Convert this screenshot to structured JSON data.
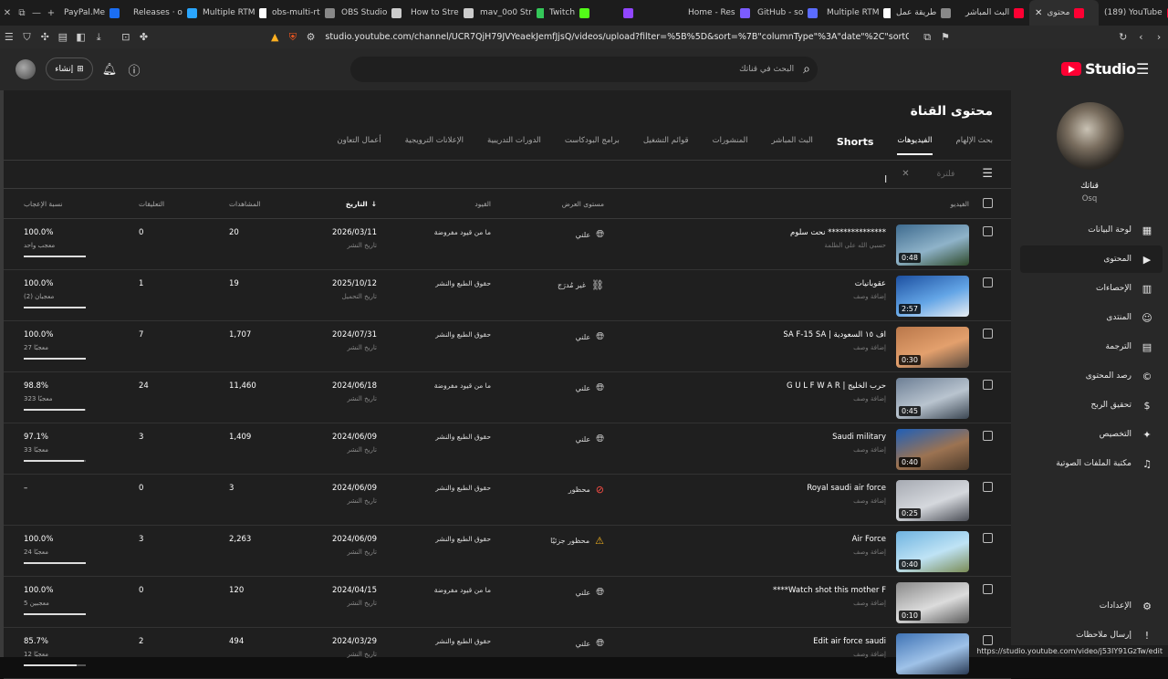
{
  "browser": {
    "tabs": [
      {
        "label": "PayPal.Me",
        "color": "#1b6ef3"
      },
      {
        "label": "Releases · o",
        "color": "#2aa6ff"
      },
      {
        "label": "Multiple RTM",
        "color": "#ffffff"
      },
      {
        "label": "obs-multi-rt",
        "color": "#888888"
      },
      {
        "label": "OBS Studio",
        "color": "#cccccc"
      },
      {
        "label": "How to Stre",
        "color": "#cccccc"
      },
      {
        "label": "mav_0o0 Str",
        "color": "#34c759"
      },
      {
        "label": "Twitch",
        "color": "#53fc18"
      },
      {
        "label": "",
        "color": "#9146ff"
      },
      {
        "label": "Home - Res",
        "color": "#7b5cff"
      },
      {
        "label": "GitHub - so",
        "color": "#5b6cff"
      },
      {
        "label": "Multiple RTM",
        "color": "#ffffff"
      },
      {
        "label": "طريقة عمل",
        "color": "#888888"
      },
      {
        "label": "البث المباشر",
        "color": "#ff0033"
      },
      {
        "label": "محتوى",
        "color": "#ff0033",
        "active": true
      },
      {
        "label": "(189) YouTube",
        "color": "#ff0033"
      }
    ],
    "url": "studio.youtube.com/channel/UCR7QjH79JVYeaekJemfJjsQ/videos/upload?filter=%5B%5D&sort=%7B\"columnType\"%3A\"date\"%2C\"sortOrder\"%3A\"D...",
    "status_url": "https://studio.youtube.com/video/j53IY91GzTw/edit"
  },
  "header": {
    "create_label": "إنشاء",
    "search_placeholder": "البحث في قناتك",
    "logo_text": "Studio"
  },
  "sidebar": {
    "channel_name": "قناتك",
    "channel_handle": "Osq",
    "items": [
      {
        "label": "لوحة البيانات",
        "icon": "dashboard-icon",
        "glyph": "▦"
      },
      {
        "label": "المحتوى",
        "icon": "content-icon",
        "glyph": "▶",
        "active": true
      },
      {
        "label": "الإحصاءات",
        "icon": "analytics-icon",
        "glyph": "▥"
      },
      {
        "label": "المنتدى",
        "icon": "community-icon",
        "glyph": "☺"
      },
      {
        "label": "الترجمة",
        "icon": "subtitles-icon",
        "glyph": "▤"
      },
      {
        "label": "رصد المحتوى",
        "icon": "copyright-icon",
        "glyph": "©"
      },
      {
        "label": "تحقيق الربح",
        "icon": "monetization-icon",
        "glyph": "$"
      },
      {
        "label": "التخصيص",
        "icon": "customization-icon",
        "glyph": "✦"
      },
      {
        "label": "مكتبة الملفات الصوتية",
        "icon": "audio-library-icon",
        "glyph": "♫"
      }
    ],
    "settings_label": "الإعدادات",
    "feedback_label": "إرسال ملاحظات"
  },
  "main": {
    "title": "محتوى القناة",
    "tabs": [
      {
        "label": "بحث الإلهام"
      },
      {
        "label": "الفيديوهات",
        "active": true
      },
      {
        "label": "Shorts",
        "bold": true
      },
      {
        "label": "البث المباشر"
      },
      {
        "label": "المنشورات"
      },
      {
        "label": "قوائم التشغيل"
      },
      {
        "label": "برامج البودكاست"
      },
      {
        "label": "الدورات التدريبية"
      },
      {
        "label": "الإعلانات الترويجية"
      },
      {
        "label": "أعمال التعاون"
      }
    ],
    "filter_placeholder": "فلترة",
    "columns": {
      "video": "الفيديو",
      "visibility": "مستوى العرض",
      "restrictions": "القيود",
      "date": "التاريخ",
      "views": "المشاهدات",
      "comments": "التعليقات",
      "likes": "نسبة الإعجاب"
    },
    "rows": [
      {
        "title": "نحت سلوم ***************",
        "desc": "حسبي الله علي الظلمة",
        "duration": "0:48",
        "visibility": "علني",
        "vis_icon": "globe",
        "restrictions": "ما من قيود مفروضة",
        "date": "2026/03/11",
        "date_sub": "تاريخ النشر",
        "views": "20",
        "comments": "0",
        "likes": "100.0%",
        "likes_sub": "معجب واحد",
        "like_ratio": 1.0,
        "thumb": [
          "#3e6b8f",
          "#8fb3c9",
          "#2f4a2a"
        ]
      },
      {
        "title": "عقوبانيات",
        "desc": "إضافة وصف",
        "duration": "2:57",
        "visibility": "غير مُدرَج",
        "vis_icon": "link",
        "restrictions": "حقوق الطبع والنشر",
        "date": "2025/10/12",
        "date_sub": "تاريخ التحميل",
        "views": "19",
        "comments": "1",
        "likes": "100.0%",
        "likes_sub": "معجبان (2)",
        "like_ratio": 1.0,
        "thumb": [
          "#1c4fa0",
          "#63a5e6",
          "#e9eef3"
        ]
      },
      {
        "title": "SA F-15 SA | اف ١٥ السعودية",
        "desc": "إضافة وصف",
        "duration": "0:30",
        "visibility": "علني",
        "vis_icon": "globe",
        "restrictions": "حقوق الطبع والنشر",
        "date": "2024/07/31",
        "date_sub": "تاريخ النشر",
        "views": "1,707",
        "comments": "7",
        "likes": "100.0%",
        "likes_sub": "27 معجبًا",
        "like_ratio": 1.0,
        "thumb": [
          "#b9774a",
          "#e3a06d",
          "#5a4a3e"
        ]
      },
      {
        "title": "G U L F W A R | حرب الخليج",
        "desc": "إضافة وصف",
        "duration": "0:45",
        "visibility": "علني",
        "vis_icon": "globe",
        "restrictions": "ما من قيود مفروضة",
        "date": "2024/06/18",
        "date_sub": "تاريخ النشر",
        "views": "11,460",
        "comments": "24",
        "likes": "98.8%",
        "likes_sub": "323 معجبًا",
        "like_ratio": 0.988,
        "thumb": [
          "#6d7f95",
          "#b9c4cf",
          "#3b4652"
        ]
      },
      {
        "title": "Saudi military",
        "desc": "إضافة وصف",
        "duration": "0:40",
        "visibility": "علني",
        "vis_icon": "globe",
        "restrictions": "حقوق الطبع والنشر",
        "date": "2024/06/09",
        "date_sub": "تاريخ النشر",
        "views": "1,409",
        "comments": "3",
        "likes": "97.1%",
        "likes_sub": "33 معجبًا",
        "like_ratio": 0.971,
        "thumb": [
          "#1f5fb8",
          "#9c7352",
          "#4c3a2a"
        ]
      },
      {
        "title": "Royal saudi air force",
        "desc": "إضافة وصف",
        "duration": "0:25",
        "visibility": "محظور",
        "vis_icon": "blocked",
        "restrictions": "حقوق الطبع والنشر",
        "date": "2024/06/09",
        "date_sub": "تاريخ النشر",
        "views": "3",
        "comments": "0",
        "likes": "–",
        "likes_sub": "",
        "like_ratio": null,
        "thumb": [
          "#a6aab2",
          "#d5d8dd",
          "#4a4d55"
        ]
      },
      {
        "title": "Air Force",
        "desc": "إضافة وصف",
        "duration": "0:40",
        "visibility": "محظور جزئيًا",
        "vis_icon": "warning",
        "restrictions": "حقوق الطبع والنشر",
        "date": "2024/06/09",
        "date_sub": "تاريخ النشر",
        "views": "2,263",
        "comments": "3",
        "likes": "100.0%",
        "likes_sub": "24 معجبًا",
        "like_ratio": 1.0,
        "thumb": [
          "#6fb3e0",
          "#bfe3f5",
          "#7a8c55"
        ]
      },
      {
        "title": "****Watch shot this mother F",
        "desc": "إضافة وصف",
        "duration": "0:10",
        "visibility": "علني",
        "vis_icon": "globe",
        "restrictions": "ما من قيود مفروضة",
        "date": "2024/04/15",
        "date_sub": "تاريخ النشر",
        "views": "120",
        "comments": "0",
        "likes": "100.0%",
        "likes_sub": "5 معجبين",
        "like_ratio": 1.0,
        "thumb": [
          "#8a8a8a",
          "#dcdcdc",
          "#5a5a5a"
        ]
      },
      {
        "title": "Edit air force saudi",
        "desc": "إضافة وصف",
        "duration": "",
        "visibility": "علني",
        "vis_icon": "globe",
        "restrictions": "حقوق الطبع والنشر",
        "date": "2024/03/29",
        "date_sub": "تاريخ النشر",
        "views": "494",
        "comments": "2",
        "likes": "85.7%",
        "likes_sub": "12 معجبًا",
        "like_ratio": 0.857,
        "thumb": [
          "#3f73b5",
          "#9fc2e8",
          "#2a3b55"
        ]
      }
    ]
  }
}
